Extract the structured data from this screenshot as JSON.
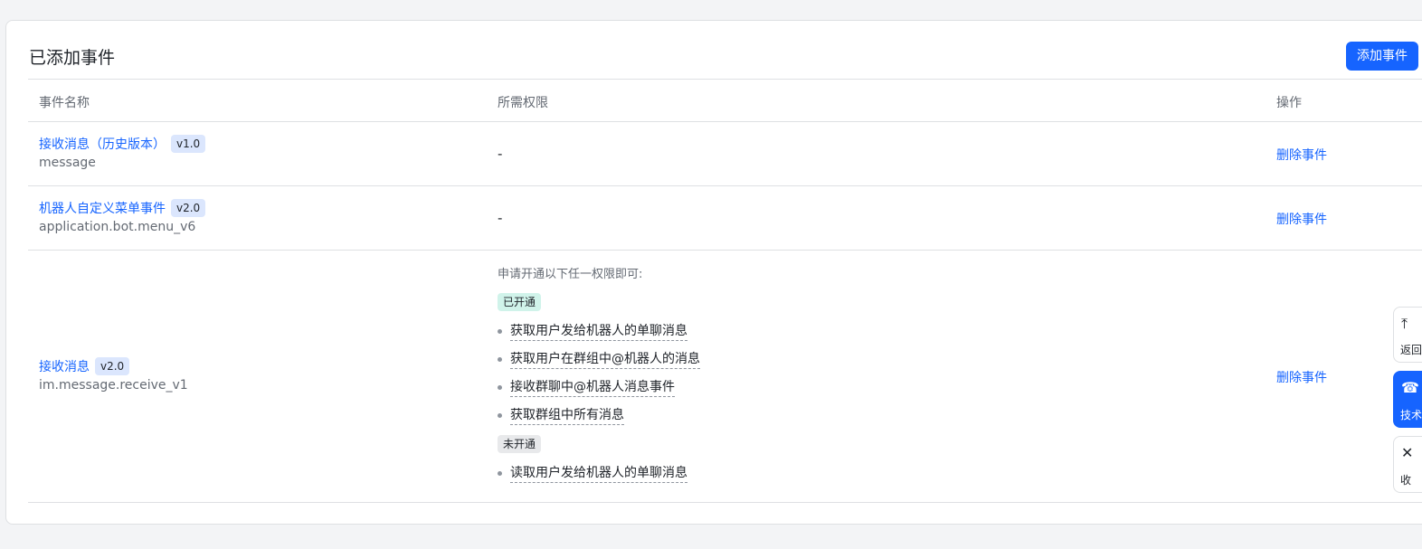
{
  "header": {
    "title": "已添加事件",
    "add_button": "添加事件"
  },
  "table": {
    "columns": [
      "事件名称",
      "所需权限",
      "操作"
    ],
    "rows": [
      {
        "name": "接收消息（历史版本）",
        "version": "v1.0",
        "key": "message",
        "permission": "-",
        "action": "删除事件"
      },
      {
        "name": "机器人自定义菜单事件",
        "version": "v2.0",
        "key": "application.bot.menu_v6",
        "permission": "-",
        "action": "删除事件"
      },
      {
        "name": "接收消息",
        "version": "v2.0",
        "key": "im.message.receive_v1",
        "action": "删除事件",
        "permission_intro": "申请开通以下任一权限即可:",
        "enabled_tag": "已开通",
        "enabled": [
          "获取用户发给机器人的单聊消息",
          "获取用户在群组中@机器人的消息",
          "接收群聊中@机器人消息事件",
          "获取群组中所有消息"
        ],
        "disabled_tag": "未开通",
        "disabled": [
          "读取用户发给机器人的单聊消息"
        ]
      }
    ]
  },
  "float_bar": [
    {
      "label": "返回",
      "icon": "back-to-top-icon"
    },
    {
      "label": "技术",
      "icon": "support-icon"
    },
    {
      "label": "收",
      "icon": "collapse-icon"
    }
  ]
}
